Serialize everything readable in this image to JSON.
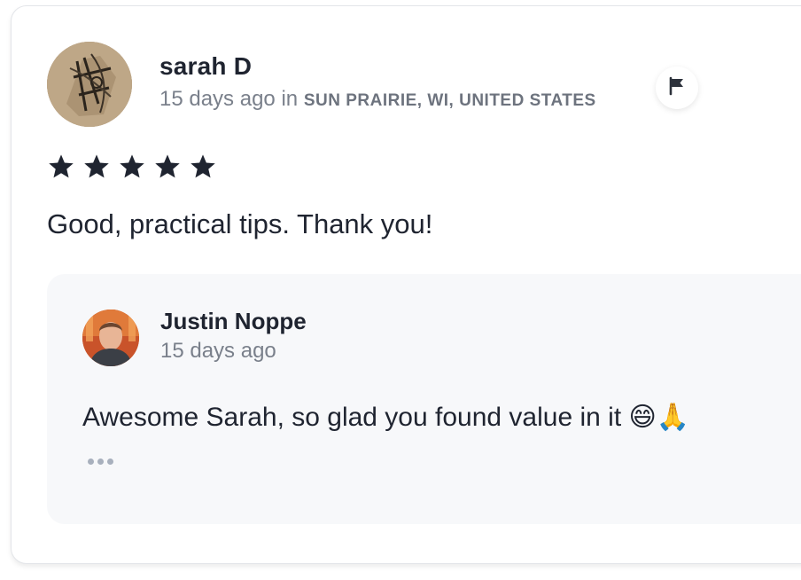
{
  "review": {
    "author": "sarah D",
    "time_ago": "15 days ago",
    "in_word": "in",
    "location": "SUN PRAIRIE, WI, UNITED STATES",
    "rating": 5,
    "rating_max": 5,
    "text": "Good, practical tips. Thank you!"
  },
  "reply": {
    "author": "Justin Noppe",
    "time_ago": "15 days ago",
    "text": "Awesome Sarah, so glad you found value in it 😄🙏"
  },
  "icons": {
    "flag": "flag-icon",
    "star": "star-icon",
    "more": "more-dots-icon"
  },
  "colors": {
    "text": "#1f2430",
    "muted": "#7a808b",
    "star": "#1f2430",
    "reply_bg": "#f7f8fa"
  }
}
